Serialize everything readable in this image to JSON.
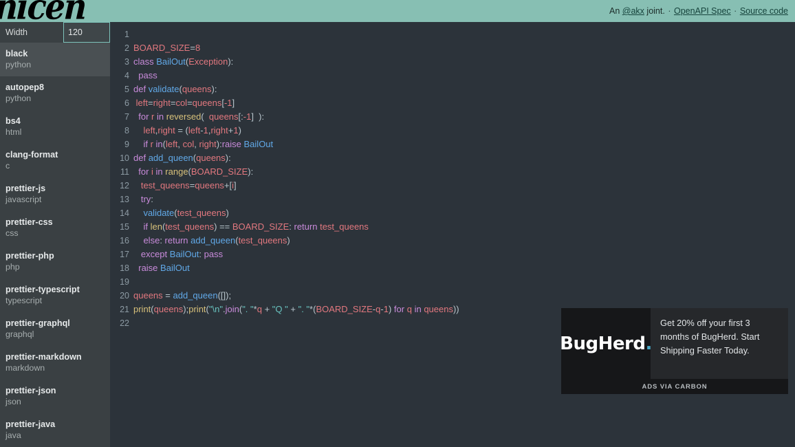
{
  "header": {
    "logo_text": "nicen",
    "byline_prefix": "An ",
    "handle": "@akx",
    "byline_suffix": " joint.",
    "sep": "·",
    "link_spec": "OpenAPI Spec",
    "link_source": "Source code",
    "bg_color": "#87bfb3"
  },
  "sidebar": {
    "width_label": "Width",
    "width_value": "120",
    "width_placeholder": "120",
    "items": [
      {
        "name": "black",
        "lang": "python",
        "active": true
      },
      {
        "name": "autopep8",
        "lang": "python",
        "active": false
      },
      {
        "name": "bs4",
        "lang": "html",
        "active": false
      },
      {
        "name": "clang-format",
        "lang": "c",
        "active": false
      },
      {
        "name": "prettier-js",
        "lang": "javascript",
        "active": false
      },
      {
        "name": "prettier-css",
        "lang": "css",
        "active": false
      },
      {
        "name": "prettier-php",
        "lang": "php",
        "active": false
      },
      {
        "name": "prettier-typescript",
        "lang": "typescript",
        "active": false
      },
      {
        "name": "prettier-graphql",
        "lang": "graphql",
        "active": false
      },
      {
        "name": "prettier-markdown",
        "lang": "markdown",
        "active": false
      },
      {
        "name": "prettier-json",
        "lang": "json",
        "active": false
      },
      {
        "name": "prettier-java",
        "lang": "java",
        "active": false
      }
    ]
  },
  "editor": {
    "language": "python",
    "line_count": 22,
    "lines": [
      {
        "n": 1,
        "tokens": []
      },
      {
        "n": 2,
        "tokens": [
          {
            "t": "var",
            "s": "BOARD_SIZE"
          },
          {
            "t": "op",
            "s": "="
          },
          {
            "t": "num",
            "s": "8"
          }
        ]
      },
      {
        "n": 3,
        "tokens": [
          {
            "t": "kw",
            "s": "class"
          },
          {
            "t": "pn",
            "s": " "
          },
          {
            "t": "fn",
            "s": "BailOut"
          },
          {
            "t": "pn",
            "s": "("
          },
          {
            "t": "var",
            "s": "Exception"
          },
          {
            "t": "pn",
            "s": "):"
          }
        ]
      },
      {
        "n": 4,
        "tokens": [
          {
            "t": "pn",
            "s": "  "
          },
          {
            "t": "kw",
            "s": "pass"
          }
        ]
      },
      {
        "n": 5,
        "tokens": [
          {
            "t": "kw",
            "s": "def"
          },
          {
            "t": "pn",
            "s": " "
          },
          {
            "t": "fn",
            "s": "validate"
          },
          {
            "t": "pn",
            "s": "("
          },
          {
            "t": "var",
            "s": "queens"
          },
          {
            "t": "pn",
            "s": "):"
          }
        ]
      },
      {
        "n": 6,
        "tokens": [
          {
            "t": "pn",
            "s": " "
          },
          {
            "t": "var",
            "s": "left"
          },
          {
            "t": "op",
            "s": "="
          },
          {
            "t": "var",
            "s": "right"
          },
          {
            "t": "op",
            "s": "="
          },
          {
            "t": "var",
            "s": "col"
          },
          {
            "t": "op",
            "s": "="
          },
          {
            "t": "var",
            "s": "queens"
          },
          {
            "t": "pn",
            "s": "["
          },
          {
            "t": "num",
            "s": "-1"
          },
          {
            "t": "pn",
            "s": "]"
          }
        ]
      },
      {
        "n": 7,
        "tokens": [
          {
            "t": "pn",
            "s": "  "
          },
          {
            "t": "kw",
            "s": "for"
          },
          {
            "t": "pn",
            "s": " "
          },
          {
            "t": "var",
            "s": "r"
          },
          {
            "t": "pn",
            "s": " "
          },
          {
            "t": "kw",
            "s": "in"
          },
          {
            "t": "pn",
            "s": " "
          },
          {
            "t": "bi",
            "s": "reversed"
          },
          {
            "t": "pn",
            "s": "(  "
          },
          {
            "t": "var",
            "s": "queens"
          },
          {
            "t": "pn",
            "s": "[:"
          },
          {
            "t": "num",
            "s": "-1"
          },
          {
            "t": "pn",
            "s": "]  ):"
          }
        ]
      },
      {
        "n": 8,
        "tokens": [
          {
            "t": "pn",
            "s": "    "
          },
          {
            "t": "var",
            "s": "left"
          },
          {
            "t": "pn",
            "s": ","
          },
          {
            "t": "var",
            "s": "right"
          },
          {
            "t": "pn",
            "s": " "
          },
          {
            "t": "op",
            "s": "="
          },
          {
            "t": "pn",
            "s": " ("
          },
          {
            "t": "var",
            "s": "left"
          },
          {
            "t": "op",
            "s": "-"
          },
          {
            "t": "num",
            "s": "1"
          },
          {
            "t": "pn",
            "s": ","
          },
          {
            "t": "var",
            "s": "right"
          },
          {
            "t": "op",
            "s": "+"
          },
          {
            "t": "num",
            "s": "1"
          },
          {
            "t": "pn",
            "s": ")"
          }
        ]
      },
      {
        "n": 9,
        "tokens": [
          {
            "t": "pn",
            "s": "    "
          },
          {
            "t": "kw",
            "s": "if"
          },
          {
            "t": "pn",
            "s": " "
          },
          {
            "t": "var",
            "s": "r"
          },
          {
            "t": "pn",
            "s": " "
          },
          {
            "t": "kw",
            "s": "in"
          },
          {
            "t": "pn",
            "s": "("
          },
          {
            "t": "var",
            "s": "left"
          },
          {
            "t": "pn",
            "s": ", "
          },
          {
            "t": "var",
            "s": "col"
          },
          {
            "t": "pn",
            "s": ", "
          },
          {
            "t": "var",
            "s": "right"
          },
          {
            "t": "pn",
            "s": "):"
          },
          {
            "t": "kw",
            "s": "raise"
          },
          {
            "t": "pn",
            "s": " "
          },
          {
            "t": "fn",
            "s": "BailOut"
          }
        ]
      },
      {
        "n": 10,
        "tokens": [
          {
            "t": "kw",
            "s": "def"
          },
          {
            "t": "pn",
            "s": " "
          },
          {
            "t": "fn",
            "s": "add_queen"
          },
          {
            "t": "pn",
            "s": "("
          },
          {
            "t": "var",
            "s": "queens"
          },
          {
            "t": "pn",
            "s": "):"
          }
        ]
      },
      {
        "n": 11,
        "tokens": [
          {
            "t": "pn",
            "s": "  "
          },
          {
            "t": "kw",
            "s": "for"
          },
          {
            "t": "pn",
            "s": " "
          },
          {
            "t": "var",
            "s": "i"
          },
          {
            "t": "pn",
            "s": " "
          },
          {
            "t": "kw",
            "s": "in"
          },
          {
            "t": "pn",
            "s": " "
          },
          {
            "t": "bi",
            "s": "range"
          },
          {
            "t": "pn",
            "s": "("
          },
          {
            "t": "var",
            "s": "BOARD_SIZE"
          },
          {
            "t": "pn",
            "s": "):"
          }
        ]
      },
      {
        "n": 12,
        "tokens": [
          {
            "t": "pn",
            "s": "   "
          },
          {
            "t": "var",
            "s": "test_queens"
          },
          {
            "t": "op",
            "s": "="
          },
          {
            "t": "var",
            "s": "queens"
          },
          {
            "t": "op",
            "s": "+"
          },
          {
            "t": "pn",
            "s": "["
          },
          {
            "t": "var",
            "s": "i"
          },
          {
            "t": "pn",
            "s": "]"
          }
        ]
      },
      {
        "n": 13,
        "tokens": [
          {
            "t": "pn",
            "s": "   "
          },
          {
            "t": "kw",
            "s": "try"
          },
          {
            "t": "pn",
            "s": ":"
          }
        ]
      },
      {
        "n": 14,
        "tokens": [
          {
            "t": "pn",
            "s": "    "
          },
          {
            "t": "fn",
            "s": "validate"
          },
          {
            "t": "pn",
            "s": "("
          },
          {
            "t": "var",
            "s": "test_queens"
          },
          {
            "t": "pn",
            "s": ")"
          }
        ]
      },
      {
        "n": 15,
        "tokens": [
          {
            "t": "pn",
            "s": "    "
          },
          {
            "t": "kw",
            "s": "if"
          },
          {
            "t": "pn",
            "s": " "
          },
          {
            "t": "bi",
            "s": "len"
          },
          {
            "t": "pn",
            "s": "("
          },
          {
            "t": "var",
            "s": "test_queens"
          },
          {
            "t": "pn",
            "s": ") "
          },
          {
            "t": "op",
            "s": "=="
          },
          {
            "t": "pn",
            "s": " "
          },
          {
            "t": "var",
            "s": "BOARD_SIZE"
          },
          {
            "t": "pn",
            "s": ": "
          },
          {
            "t": "kw",
            "s": "return"
          },
          {
            "t": "pn",
            "s": " "
          },
          {
            "t": "var",
            "s": "test_queens"
          }
        ]
      },
      {
        "n": 16,
        "tokens": [
          {
            "t": "pn",
            "s": "    "
          },
          {
            "t": "kw",
            "s": "else"
          },
          {
            "t": "pn",
            "s": ": "
          },
          {
            "t": "kw",
            "s": "return"
          },
          {
            "t": "pn",
            "s": " "
          },
          {
            "t": "fn",
            "s": "add_queen"
          },
          {
            "t": "pn",
            "s": "("
          },
          {
            "t": "var",
            "s": "test_queens"
          },
          {
            "t": "pn",
            "s": ")"
          }
        ]
      },
      {
        "n": 17,
        "tokens": [
          {
            "t": "pn",
            "s": "   "
          },
          {
            "t": "kw",
            "s": "except"
          },
          {
            "t": "pn",
            "s": " "
          },
          {
            "t": "fn",
            "s": "BailOut"
          },
          {
            "t": "pn",
            "s": ": "
          },
          {
            "t": "kw",
            "s": "pass"
          }
        ]
      },
      {
        "n": 18,
        "tokens": [
          {
            "t": "pn",
            "s": "  "
          },
          {
            "t": "kw",
            "s": "raise"
          },
          {
            "t": "pn",
            "s": " "
          },
          {
            "t": "fn",
            "s": "BailOut"
          }
        ]
      },
      {
        "n": 19,
        "tokens": []
      },
      {
        "n": 20,
        "tokens": [
          {
            "t": "var",
            "s": "queens"
          },
          {
            "t": "pn",
            "s": " "
          },
          {
            "t": "op",
            "s": "="
          },
          {
            "t": "pn",
            "s": " "
          },
          {
            "t": "fn",
            "s": "add_queen"
          },
          {
            "t": "pn",
            "s": "([]);"
          }
        ]
      },
      {
        "n": 21,
        "tokens": [
          {
            "t": "bi",
            "s": "print"
          },
          {
            "t": "pn",
            "s": "("
          },
          {
            "t": "var",
            "s": "queens"
          },
          {
            "t": "pn",
            "s": ");"
          },
          {
            "t": "bi",
            "s": "print"
          },
          {
            "t": "pn",
            "s": "("
          },
          {
            "t": "str",
            "s": "\"\\n\""
          },
          {
            "t": "pn",
            "s": "."
          },
          {
            "t": "at",
            "s": "join"
          },
          {
            "t": "pn",
            "s": "("
          },
          {
            "t": "str",
            "s": "\". \""
          },
          {
            "t": "op",
            "s": "*"
          },
          {
            "t": "var",
            "s": "q"
          },
          {
            "t": "pn",
            "s": " "
          },
          {
            "t": "op",
            "s": "+"
          },
          {
            "t": "pn",
            "s": " "
          },
          {
            "t": "str",
            "s": "\"Q \""
          },
          {
            "t": "pn",
            "s": " "
          },
          {
            "t": "op",
            "s": "+"
          },
          {
            "t": "pn",
            "s": " "
          },
          {
            "t": "str",
            "s": "\". \""
          },
          {
            "t": "op",
            "s": "*"
          },
          {
            "t": "pn",
            "s": "("
          },
          {
            "t": "var",
            "s": "BOARD_SIZE"
          },
          {
            "t": "op",
            "s": "-"
          },
          {
            "t": "var",
            "s": "q"
          },
          {
            "t": "op",
            "s": "-"
          },
          {
            "t": "num",
            "s": "1"
          },
          {
            "t": "pn",
            "s": ") "
          },
          {
            "t": "kw",
            "s": "for"
          },
          {
            "t": "pn",
            "s": " "
          },
          {
            "t": "var",
            "s": "q"
          },
          {
            "t": "pn",
            "s": " "
          },
          {
            "t": "kw",
            "s": "in"
          },
          {
            "t": "pn",
            "s": " "
          },
          {
            "t": "var",
            "s": "queens"
          },
          {
            "t": "pn",
            "s": "))"
          }
        ]
      },
      {
        "n": 22,
        "tokens": []
      }
    ]
  },
  "ad": {
    "logo_name": "BugHerd",
    "logo_dot": ".",
    "body": "Get 20% off your first 3 months of BugHerd. Start Shipping Faster Today.",
    "footer": "ADS VIA CARBON"
  }
}
